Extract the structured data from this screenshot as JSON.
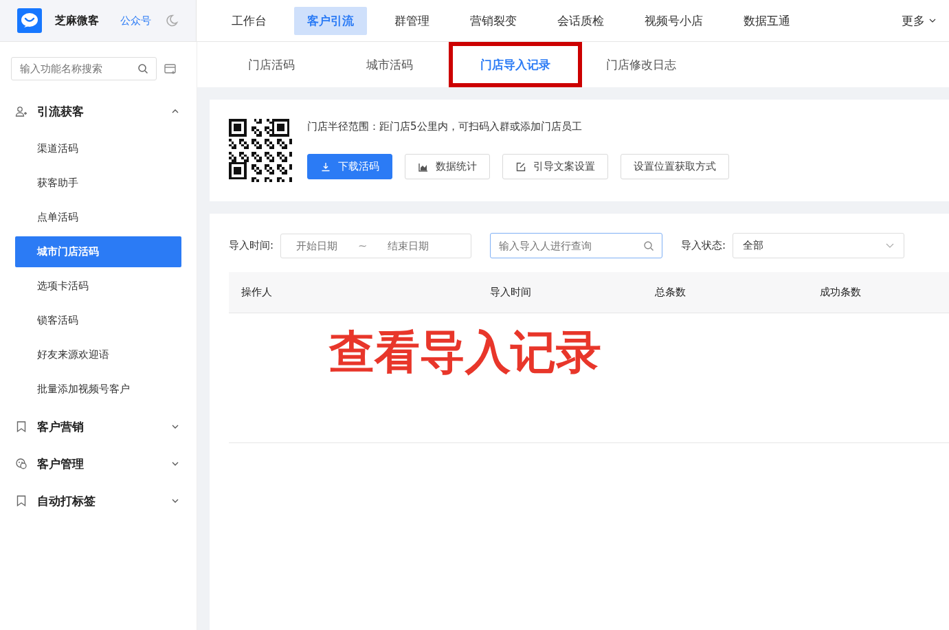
{
  "brand": {
    "name": "芝麻微客",
    "link": "公众号"
  },
  "nav": [
    {
      "label": "工作台",
      "selected": false
    },
    {
      "label": "客户引流",
      "selected": true
    },
    {
      "label": "群管理",
      "selected": false
    },
    {
      "label": "营销裂变",
      "selected": false
    },
    {
      "label": "会话质检",
      "selected": false
    },
    {
      "label": "视频号小店",
      "selected": false
    },
    {
      "label": "数据互通",
      "selected": false
    },
    {
      "label": "更多",
      "selected": false,
      "kind": "dropdown"
    }
  ],
  "sidebar": {
    "search": {
      "placeholder": "输入功能名称搜索"
    },
    "groups": [
      {
        "label": "引流获客",
        "expanded": true,
        "children": [
          {
            "label": "渠道活码",
            "selected": false
          },
          {
            "label": "获客助手",
            "selected": false
          },
          {
            "label": "点单活码",
            "selected": false
          },
          {
            "label": "城市门店活码",
            "selected": true
          },
          {
            "label": "选项卡活码",
            "selected": false
          },
          {
            "label": "锁客活码",
            "selected": false
          },
          {
            "label": "好友来源欢迎语",
            "selected": false
          },
          {
            "label": "批量添加视频号客户",
            "selected": false
          }
        ]
      },
      {
        "label": "客户营销",
        "expanded": false
      },
      {
        "label": "客户管理",
        "expanded": false
      },
      {
        "label": "自动打标签",
        "expanded": false
      }
    ]
  },
  "subtabs": [
    {
      "label": "门店活码",
      "selected": false,
      "highlighted": false
    },
    {
      "label": "城市活码",
      "selected": false,
      "highlighted": false
    },
    {
      "label": "门店导入记录",
      "selected": true,
      "highlighted": true
    },
    {
      "label": "门店修改日志",
      "selected": false,
      "highlighted": false
    }
  ],
  "info": {
    "text": "门店半径范围：距门店5公里内，可扫码入群或添加门店员工",
    "buttons": [
      {
        "label": "下载活码",
        "kind": "primary"
      },
      {
        "label": "数据统计",
        "kind": "default"
      },
      {
        "label": "引导文案设置",
        "kind": "default"
      },
      {
        "label": "设置位置获取方式",
        "kind": "default"
      }
    ]
  },
  "filters": {
    "time_label": "导入时间:",
    "start_placeholder": "开始日期",
    "separator": "~",
    "end_placeholder": "结束日期",
    "search_placeholder": "输入导入人进行查询",
    "status_label": "导入状态:",
    "status_value": "全部"
  },
  "table": {
    "columns": [
      "操作人",
      "导入时间",
      "总条数",
      "成功条数"
    ]
  },
  "annotation": "查看导入记录"
}
